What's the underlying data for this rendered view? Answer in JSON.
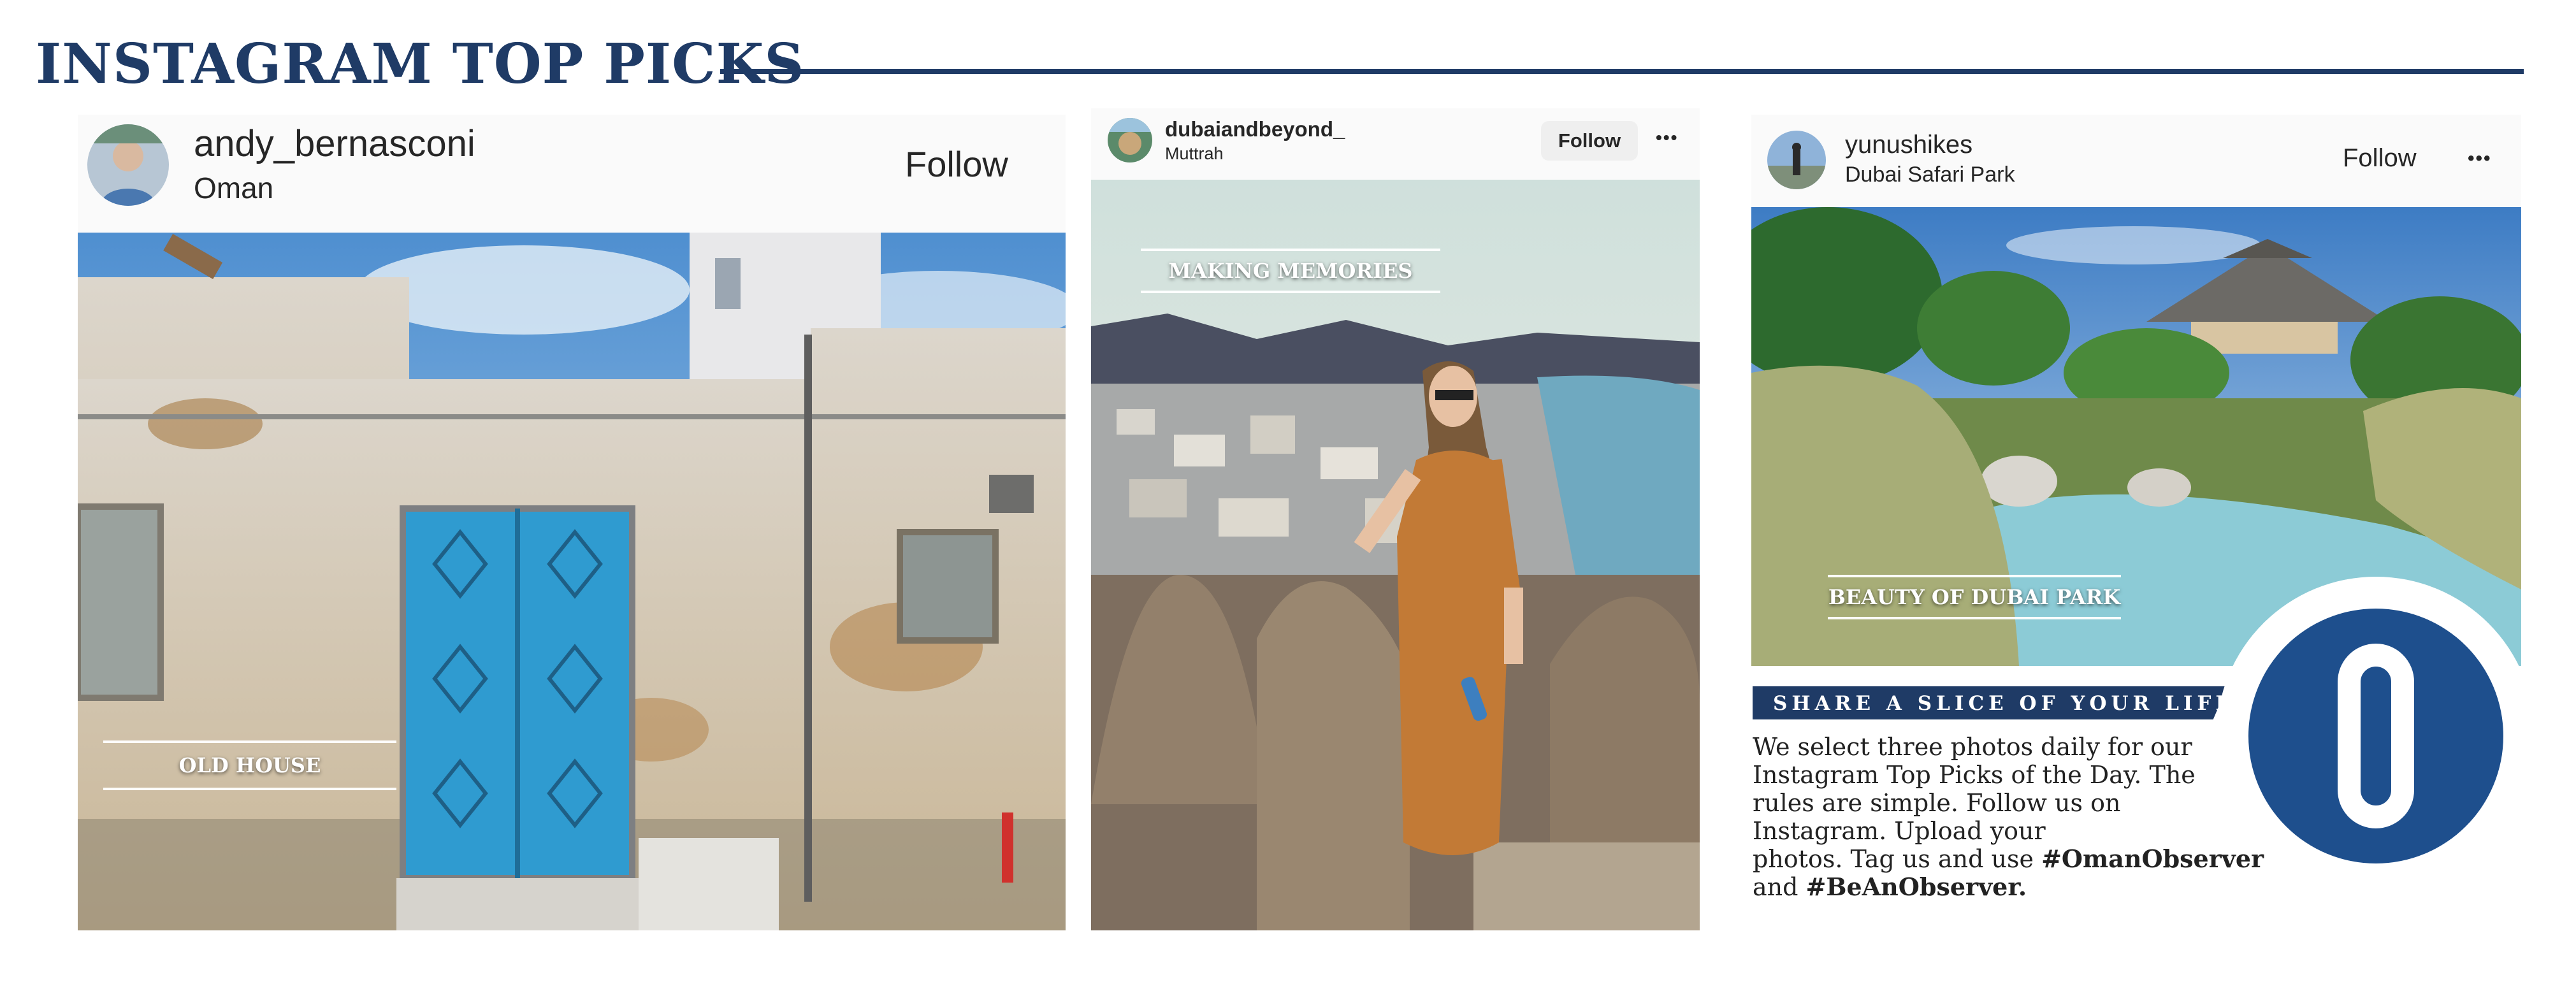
{
  "header": {
    "title": "INSTAGRAM TOP PICKS"
  },
  "posts": [
    {
      "username": "andy_bernasconi",
      "location": "Oman",
      "follow_label": "Follow",
      "caption": "OLD HOUSE"
    },
    {
      "username": "dubaiandbeyond_",
      "location": "Muttrah",
      "follow_label": "Follow",
      "more_icon": "•••",
      "caption": "MAKING MEMORIES"
    },
    {
      "username": "yunushikes",
      "location": "Dubai Safari Park",
      "follow_label": "Follow",
      "more_icon": "•••",
      "caption": "BEAUTY OF DUBAI PARK"
    }
  ],
  "info": {
    "banner": "SHARE A SLICE OF YOUR LIFE",
    "lines": [
      "We select three photos daily for our",
      "Instagram Top Picks of the Day. The",
      "rules are simple. Follow us on",
      "Instagram. Upload your"
    ],
    "line5_prefix": "photos. Tag us and use ",
    "hashtag1": "#OmanObserver",
    "line6_prefix": "and ",
    "hashtag2": "#BeAnObserver."
  },
  "colors": {
    "navy": "#1f3b66",
    "logo_blue": "#1e4f8d",
    "door_blue": "#2f9bd0"
  }
}
